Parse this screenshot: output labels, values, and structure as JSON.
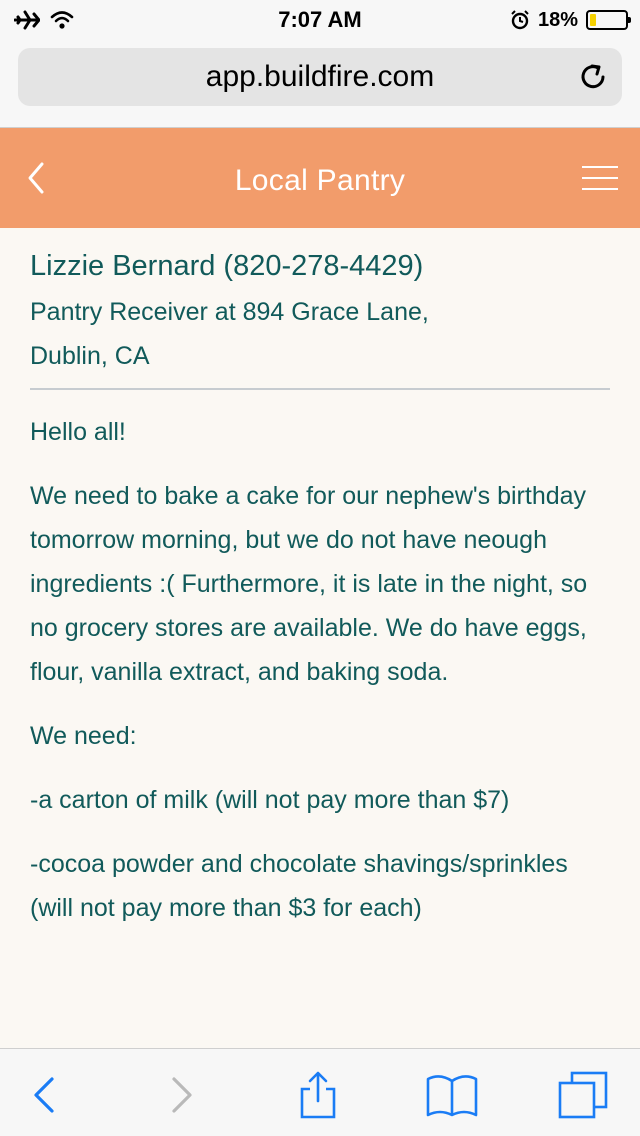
{
  "status_bar": {
    "time": "7:07 AM",
    "battery_percent": "18%",
    "battery_level": 0.18,
    "icons": [
      "airplane-icon",
      "wifi-icon",
      "alarm-icon",
      "battery-icon"
    ]
  },
  "browser": {
    "url": "app.buildfire.com"
  },
  "header": {
    "title": "Local Pantry",
    "color": "#f29c6b"
  },
  "post": {
    "poster_line": "Lizzie Bernard (820-278-4429)",
    "subtitle_line1": "Pantry Receiver at 894 Grace Lane,",
    "subtitle_line2": "Dublin, CA",
    "paragraphs": [
      "Hello all!",
      "We need to bake a cake for our nephew's birthday tomorrow morning, but we do not have neough ingredients :( Furthermore, it is late in the night, so no grocery stores are available. We do have eggs, flour, vanilla extract, and baking soda.",
      "We need:",
      "-a carton of milk (will not pay more than $7)",
      "-cocoa powder and chocolate shavings/sprinkles (will not pay more than $3 for each)"
    ]
  },
  "toolbar": {
    "accent_color": "#1a7cf5",
    "disabled_color": "#b9b9b9"
  }
}
